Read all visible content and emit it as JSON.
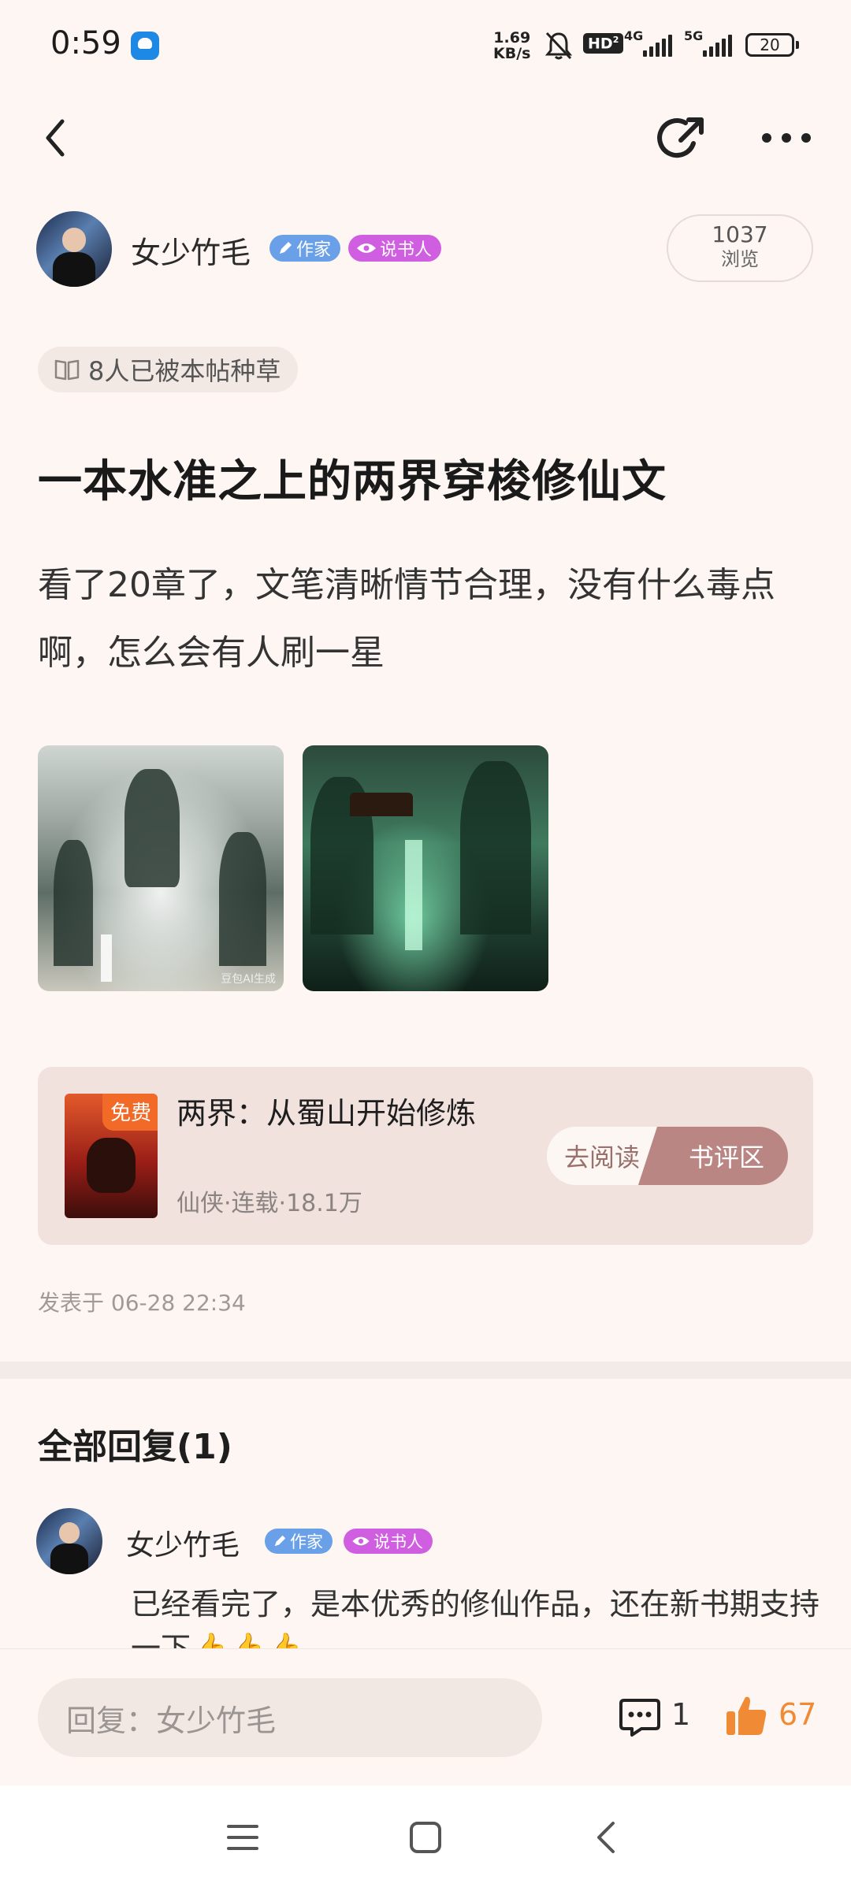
{
  "status_bar": {
    "time": "0:59",
    "net_speed_value": "1.69",
    "net_speed_unit": "KB/s",
    "hd_label": "HD",
    "net_4g": "4G",
    "net_5g": "5G",
    "battery": "20"
  },
  "header": {
    "back_icon": "chevron-left-icon",
    "share_icon": "share-icon",
    "more_icon": "more-horizontal-icon"
  },
  "author": {
    "name": "女少竹毛",
    "tag_writer": "作家",
    "tag_storyteller": "说书人",
    "views_count": "1037",
    "views_label": "浏览"
  },
  "post": {
    "seeded_text": "8人已被本帖种草",
    "title": "一本水准之上的两界穿梭修仙文",
    "body": "看了20章了，文笔清晰情节合理，没有什么毒点啊，怎么会有人刷一星",
    "image_caption": "豆包AI生成",
    "posted_at": "发表于 06-28 22:34"
  },
  "book": {
    "free_badge": "免费",
    "title": "两界：从蜀山开始修炼",
    "meta": "仙侠·连载·18.1万",
    "read_button": "去阅读",
    "review_button": "书评区"
  },
  "replies": {
    "heading": "全部回复(1)",
    "items": [
      {
        "author": "女少竹毛",
        "tag_writer": "作家",
        "tag_storyteller": "说书人",
        "text": "已经看完了，是本优秀的修仙作品，还在新书期支持一下👍👍👍"
      }
    ]
  },
  "footer": {
    "reply_placeholder": "回复：女少竹毛",
    "comment_count": "1",
    "like_count": "67"
  },
  "colors": {
    "background": "#fdf6f2",
    "accent_like": "#f08a34",
    "tag_writer": "#6aa0e8",
    "tag_storyteller": "#d05ee0",
    "review_button": "#b98684"
  }
}
